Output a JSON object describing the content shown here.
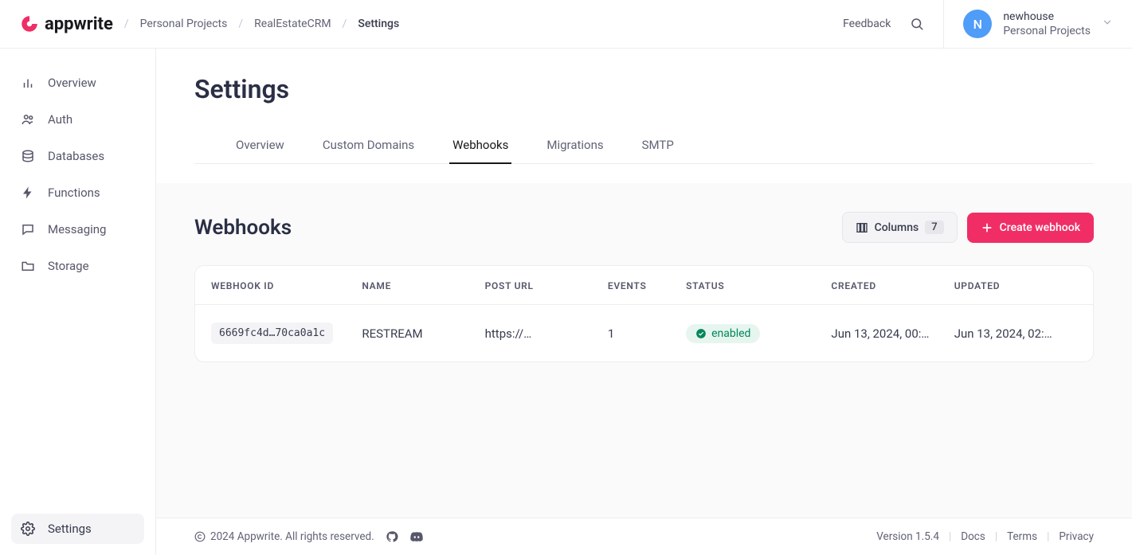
{
  "logo_text": "appwrite",
  "breadcrumb": {
    "org": "Personal Projects",
    "project": "RealEstateCRM",
    "current": "Settings"
  },
  "topbar": {
    "feedback": "Feedback"
  },
  "account": {
    "initial": "N",
    "name": "newhouse",
    "org": "Personal Projects"
  },
  "sidebar": {
    "items": [
      {
        "label": "Overview"
      },
      {
        "label": "Auth"
      },
      {
        "label": "Databases"
      },
      {
        "label": "Functions"
      },
      {
        "label": "Messaging"
      },
      {
        "label": "Storage"
      }
    ],
    "settings_label": "Settings"
  },
  "page": {
    "title": "Settings"
  },
  "tabs": [
    {
      "label": "Overview"
    },
    {
      "label": "Custom Domains"
    },
    {
      "label": "Webhooks"
    },
    {
      "label": "Migrations"
    },
    {
      "label": "SMTP"
    }
  ],
  "active_tab_index": 2,
  "section": {
    "title": "Webhooks",
    "columns_button": "Columns",
    "columns_count": "7",
    "create_button": "Create webhook"
  },
  "table": {
    "headers": [
      "WEBHOOK ID",
      "NAME",
      "POST URL",
      "EVENTS",
      "STATUS",
      "CREATED",
      "UPDATED"
    ],
    "rows": [
      {
        "id": "6669fc4d…70ca0a1c",
        "name": "RESTREAM",
        "post_url": "https://…",
        "events": "1",
        "status": "enabled",
        "created": "Jun 13, 2024, 00:…",
        "updated": "Jun 13, 2024, 02:…"
      }
    ]
  },
  "footer": {
    "copyright": "2024 Appwrite. All rights reserved.",
    "version": "Version 1.5.4",
    "docs": "Docs",
    "terms": "Terms",
    "privacy": "Privacy"
  }
}
